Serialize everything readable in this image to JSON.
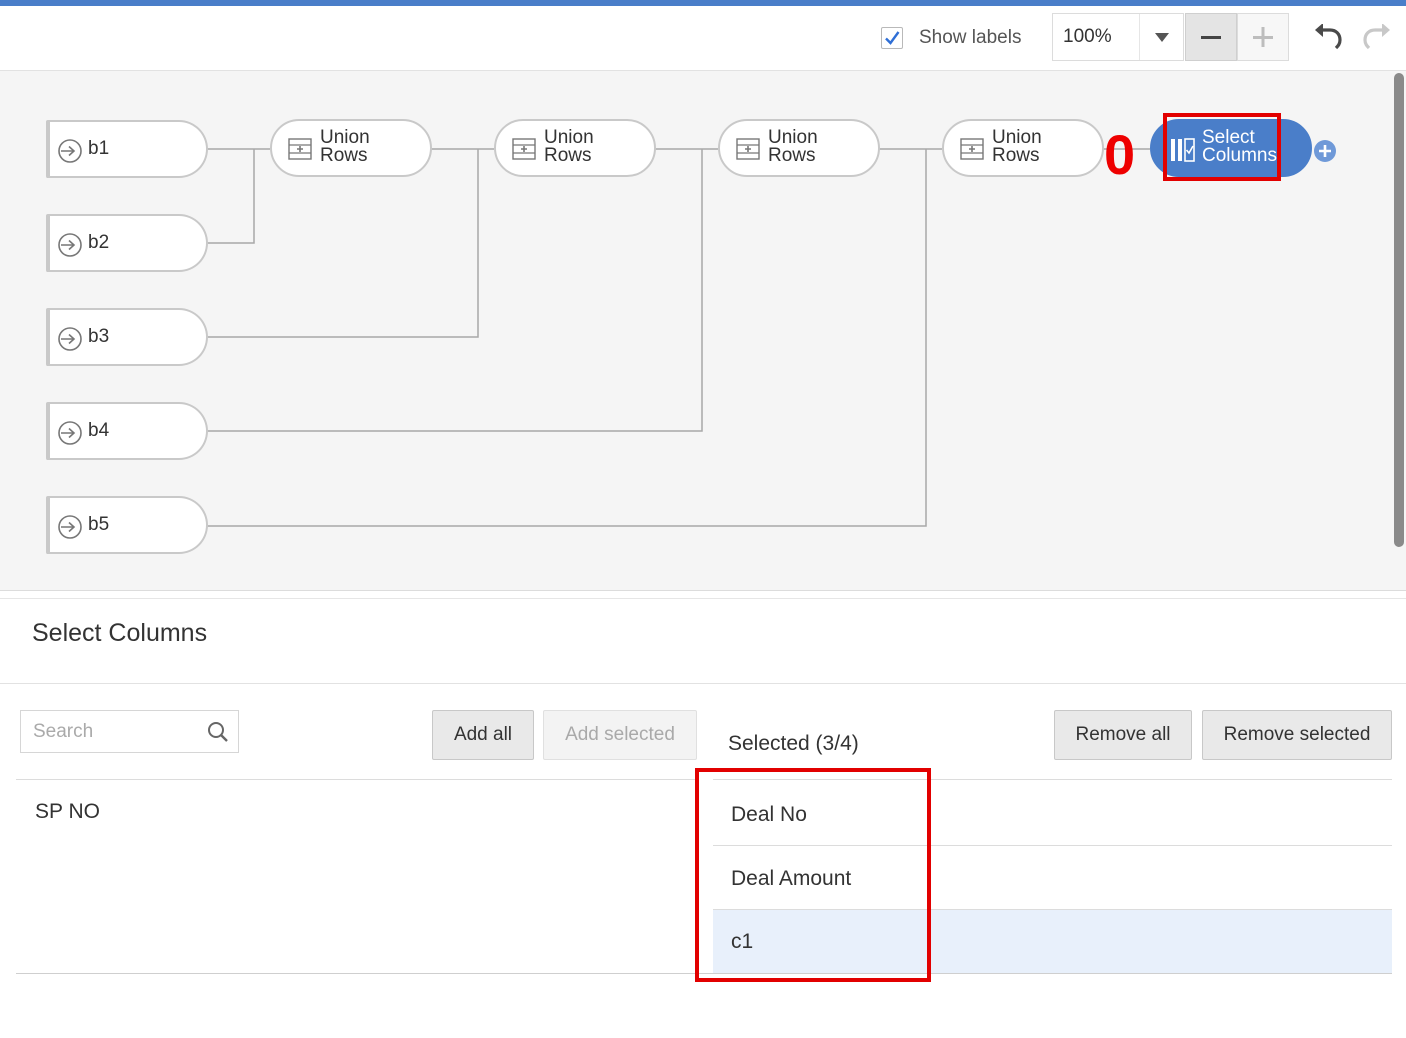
{
  "toolbar": {
    "show_labels_label": "Show labels",
    "show_labels_checked": true,
    "zoom_value": "100%",
    "icons": [
      "check-icon",
      "dropdown-arrow-icon",
      "minus-icon",
      "plus-icon",
      "undo-icon",
      "redo-icon"
    ]
  },
  "flow": {
    "sources": [
      {
        "label": "b1"
      },
      {
        "label": "b2"
      },
      {
        "label": "b3"
      },
      {
        "label": "b4"
      },
      {
        "label": "b5"
      }
    ],
    "union_nodes": [
      {
        "line1": "Union",
        "line2": "Rows"
      },
      {
        "line1": "Union",
        "line2": "Rows"
      },
      {
        "line1": "Union",
        "line2": "Rows"
      },
      {
        "line1": "Union",
        "line2": "Rows"
      }
    ],
    "select_node": {
      "line1": "Select",
      "line2": "Columns"
    },
    "annotation_zero": "0",
    "accent_color": "#4a7ec9",
    "annotation_color": "#e20000"
  },
  "panel": {
    "title": "Select Columns",
    "search_placeholder": "Search",
    "add_all_label": "Add all",
    "add_selected_label": "Add selected",
    "selected_count_label": "Selected (3/4)",
    "remove_all_label": "Remove all",
    "remove_selected_label": "Remove selected",
    "available_columns": [
      "SP NO"
    ],
    "selected_columns": [
      "Deal No",
      "Deal Amount",
      "c1"
    ]
  }
}
